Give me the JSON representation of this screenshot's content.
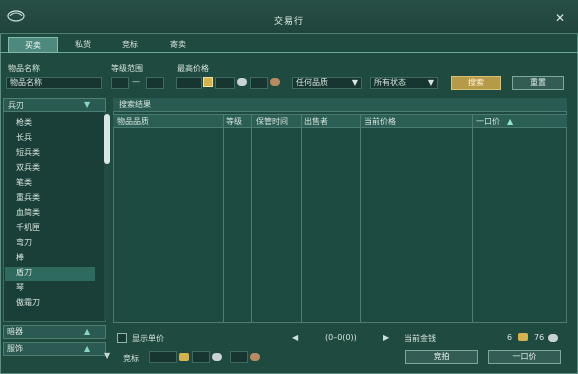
{
  "window": {
    "title": "交易行"
  },
  "tabs": [
    "买卖",
    "私货",
    "竞标",
    "寄卖"
  ],
  "filters": {
    "item_name_label": "物品名称",
    "item_name_value": "物品名称",
    "level_range_label": "等级范围",
    "range_sep": "—",
    "max_price_label": "最高价格",
    "quality_select": "任何品质",
    "status_select": "所有状态",
    "search_button": "搜索",
    "reset_button": "重置"
  },
  "sidebar": {
    "head": "兵刃",
    "items": [
      "枪类",
      "长兵",
      "短兵类",
      "双兵类",
      "笔类",
      "重兵类",
      "血简类",
      "千机匣",
      "弯刀",
      "棒",
      "盾刀",
      "琴",
      "傲霜刀"
    ],
    "categories": [
      "暗器",
      "服饰"
    ]
  },
  "results": {
    "panel_title": "搜索结果",
    "columns": [
      "物品品质",
      "等级",
      "保管时间",
      "出售者",
      "当前价格",
      "一口价"
    ]
  },
  "footer": {
    "show_unit_price": "显示单价",
    "pager": "(0–0(0))",
    "current_money_label": "当前金钱",
    "money_gold": "6",
    "money_silver": "76",
    "bid_label": "竞标",
    "bid_button": "竞拍",
    "buyout_button": "一口价"
  }
}
